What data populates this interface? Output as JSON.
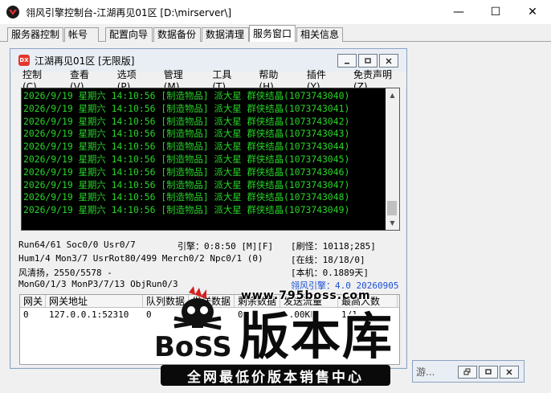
{
  "window": {
    "title": "翎风引擎控制台-江湖再见01区 [D:\\mirserver\\]",
    "controls": [
      "—",
      "☐",
      "✕"
    ]
  },
  "tabs": [
    {
      "label": "服务器控制"
    },
    {
      "label": "帐号"
    },
    {
      "label": "配置向导"
    },
    {
      "label": "数据备份"
    },
    {
      "label": "数据清理"
    },
    {
      "label": "服务窗口"
    },
    {
      "label": "相关信息"
    }
  ],
  "child": {
    "icon_text": "DX",
    "title": "江湖再见01区 [无限版]",
    "menu": [
      "控制(C)",
      "查看(V)",
      "选项(P)",
      "管理(M)",
      "工具(T)",
      "帮助(H)",
      "插件(Y)",
      "免责声明(Z)"
    ],
    "console_lines": [
      "2026/9/19 星期六 14:10:56 [制造物品] 派大星 群侠结晶(1073743040)",
      "2026/9/19 星期六 14:10:56 [制造物品] 派大星 群侠结晶(1073743041)",
      "2026/9/19 星期六 14:10:56 [制造物品] 派大星 群侠结晶(1073743042)",
      "2026/9/19 星期六 14:10:56 [制造物品] 派大星 群侠结晶(1073743043)",
      "2026/9/19 星期六 14:10:56 [制造物品] 派大星 群侠结晶(1073743044)",
      "2026/9/19 星期六 14:10:56 [制造物品] 派大星 群侠结晶(1073743045)",
      "2026/9/19 星期六 14:10:56 [制造物品] 派大星 群侠结晶(1073743046)",
      "2026/9/19 星期六 14:10:56 [制造物品] 派大星 群侠结晶(1073743047)",
      "2026/9/19 星期六 14:10:56 [制造物品] 派大星 群侠结晶(1073743048)",
      "2026/9/19 星期六 14:10:56 [制造物品] 派大星 群侠结晶(1073743049)"
    ],
    "status": {
      "run": "Run64/61 Soc0/0 Usr0/7",
      "engine": "引擎：0:8:50 [M][F]",
      "refresh": "[刷怪：10118;285]",
      "hum": "Hum1/4 Mon3/7 UsrRot80/499 Merch0/2 Npc0/1 (0)",
      "online": "[在线：18/18/0]",
      "player": "风清扬，2550/5578 -",
      "local": "[本机：0.1889天]",
      "mon": "MonG0/1/3 MonP3/7/13 ObjRun0/3",
      "version": "翎风引擎：4.0 20260905"
    },
    "grid": {
      "headers": [
        "网关",
        "网关地址",
        "队列数据",
        "发送数据",
        "剩余数据",
        "发送流量",
        "最高人数"
      ],
      "rows": [
        [
          "0",
          "127.0.0.1:52310",
          "0",
          "",
          "0",
          "1.00KB",
          "1/1"
        ]
      ]
    }
  },
  "minimized": {
    "title": "游..."
  },
  "watermark": {
    "url": "www.795boss.com",
    "boss": "BoSS",
    "big": "版本库",
    "banner": "全网最低价版本销售中心"
  },
  "colors": {
    "console_bg": "#000000",
    "console_text": "#27d627",
    "version_text": "#1a4fd6"
  }
}
